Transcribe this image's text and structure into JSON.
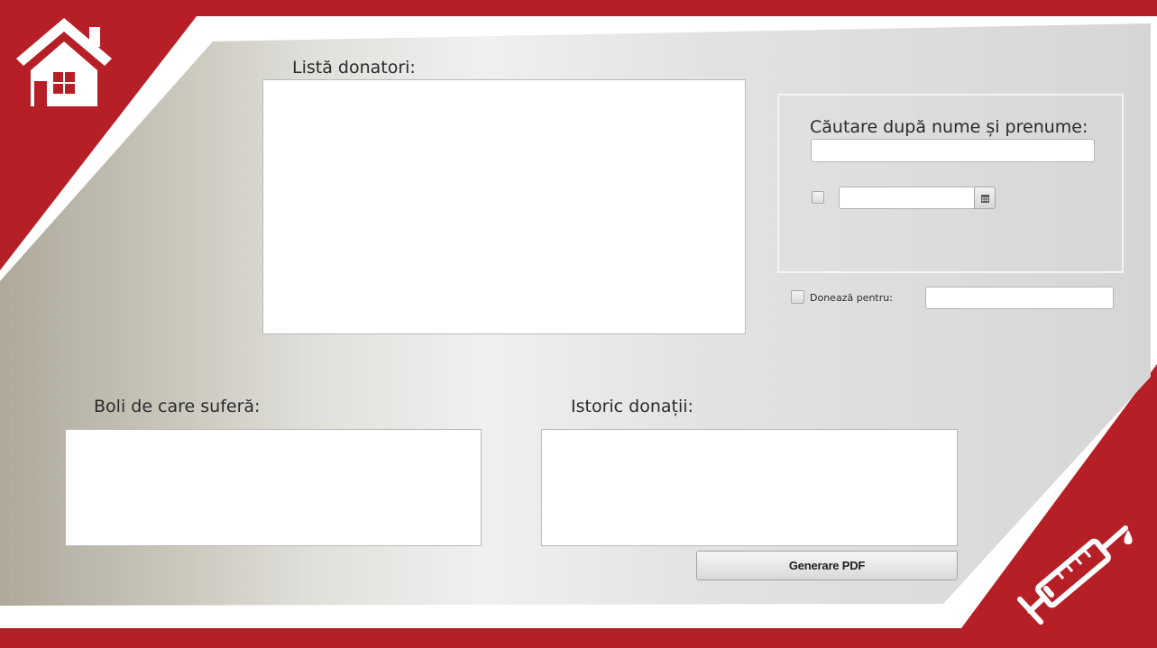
{
  "donor_list": {
    "label": "Listă donatori:"
  },
  "search": {
    "label": "Căutare după nume și prenume:",
    "name_value": "",
    "date_value": "",
    "date_checked": false
  },
  "donate_for": {
    "label": "Donează pentru:",
    "checked": false,
    "value": ""
  },
  "diseases": {
    "label": "Boli de care suferă:"
  },
  "history": {
    "label": "Istoric donații:"
  },
  "actions": {
    "generate_pdf": "Generare PDF"
  },
  "icons": {
    "home": "home-icon",
    "calendar": "calendar-icon",
    "syringe": "syringe-icon"
  },
  "colors": {
    "brand_red": "#b61f26",
    "panel_light": "#f0f0f0",
    "panel_dark": "#aea99a"
  }
}
